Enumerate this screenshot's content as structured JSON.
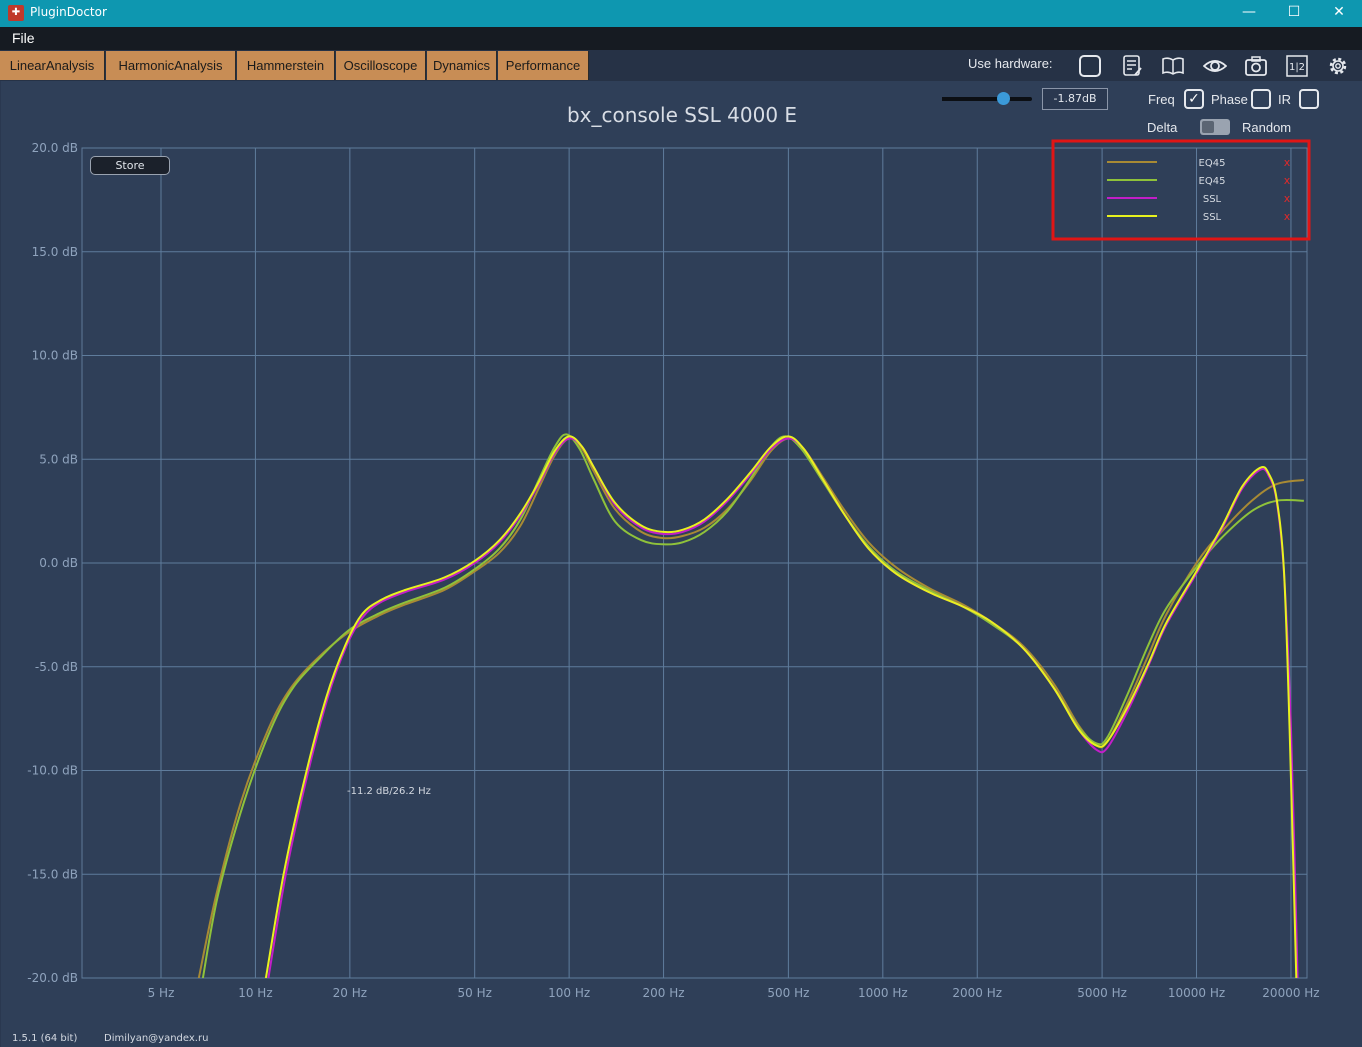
{
  "window": {
    "title": "PluginDoctor",
    "minimize": "—",
    "maximize": "☐",
    "close": "✕"
  },
  "menu": {
    "file": "File"
  },
  "tabs": [
    {
      "label": "LinearAnalysis"
    },
    {
      "label": "HarmonicAnalysis"
    },
    {
      "label": "Hammerstein"
    },
    {
      "label": "Oscilloscope"
    },
    {
      "label": "Dynamics"
    },
    {
      "label": "Performance"
    }
  ],
  "toolbar": {
    "use_hardware_label": "Use hardware:",
    "icons": [
      "hardware-checkbox-icon",
      "notes-icon",
      "book-icon",
      "eye-icon",
      "camera-icon",
      "split-view-icon",
      "settings-gear-icon"
    ],
    "split_label": "1|2"
  },
  "controls": {
    "gain_value": "-1.87dB",
    "gain_slider_fraction": 0.68,
    "freq_label": "Freq",
    "freq_checked": true,
    "phase_label": "Phase",
    "phase_checked": false,
    "ir_label": "IR",
    "ir_checked": false,
    "delta_label": "Delta",
    "random_label": "Random",
    "store_label": "Store"
  },
  "cursor_readout": "-11.2 dB/26.2 Hz",
  "footer": {
    "version": "1.5.1 (64 bit)",
    "email": "Dimilyan@yandex.ru"
  },
  "chart_data": {
    "type": "line",
    "title": "bx_console SSL 4000 E",
    "xscale": "log",
    "xlim": [
      2.8,
      22500
    ],
    "ylim": [
      -20,
      20
    ],
    "grid": true,
    "legend_position": "top-right",
    "x_ticks": [
      {
        "v": 5,
        "label": "5 Hz"
      },
      {
        "v": 10,
        "label": "10 Hz"
      },
      {
        "v": 20,
        "label": "20 Hz"
      },
      {
        "v": 50,
        "label": "50 Hz"
      },
      {
        "v": 100,
        "label": "100 Hz"
      },
      {
        "v": 200,
        "label": "200 Hz"
      },
      {
        "v": 500,
        "label": "500 Hz"
      },
      {
        "v": 1000,
        "label": "1000 Hz"
      },
      {
        "v": 2000,
        "label": "2000 Hz"
      },
      {
        "v": 5000,
        "label": "5000 Hz"
      },
      {
        "v": 10000,
        "label": "10000 Hz"
      },
      {
        "v": 20000,
        "label": "20000 Hz"
      }
    ],
    "y_ticks": [
      {
        "v": 20,
        "label": "20.0 dB"
      },
      {
        "v": 15,
        "label": "15.0 dB"
      },
      {
        "v": 10,
        "label": "10.0 dB"
      },
      {
        "v": 5,
        "label": "5.0 dB"
      },
      {
        "v": 0,
        "label": "0.0 dB"
      },
      {
        "v": -5,
        "label": "-5.0 dB"
      },
      {
        "v": -10,
        "label": "-10.0 dB"
      },
      {
        "v": -15,
        "label": "-15.0 dB"
      },
      {
        "v": -20,
        "label": "-20.0 dB"
      }
    ],
    "series": [
      {
        "name": "EQ45",
        "color": "#a88a34",
        "points": [
          [
            6.6,
            -20
          ],
          [
            7.5,
            -16
          ],
          [
            9,
            -11.5
          ],
          [
            11,
            -8
          ],
          [
            13,
            -6
          ],
          [
            16,
            -4.5
          ],
          [
            20,
            -3.3
          ],
          [
            25,
            -2.5
          ],
          [
            30,
            -2
          ],
          [
            40,
            -1.3
          ],
          [
            50,
            -0.4
          ],
          [
            60,
            0.5
          ],
          [
            70,
            1.8
          ],
          [
            80,
            3.6
          ],
          [
            90,
            5.2
          ],
          [
            100,
            6
          ],
          [
            110,
            5.5
          ],
          [
            120,
            4.4
          ],
          [
            140,
            2.6
          ],
          [
            170,
            1.5
          ],
          [
            200,
            1.2
          ],
          [
            230,
            1.3
          ],
          [
            270,
            1.7
          ],
          [
            320,
            2.6
          ],
          [
            380,
            4
          ],
          [
            440,
            5.4
          ],
          [
            500,
            6
          ],
          [
            560,
            5.5
          ],
          [
            640,
            4.2
          ],
          [
            750,
            2.6
          ],
          [
            900,
            1
          ],
          [
            1100,
            -0.2
          ],
          [
            1400,
            -1.2
          ],
          [
            1800,
            -2
          ],
          [
            2200,
            -2.8
          ],
          [
            2800,
            -4
          ],
          [
            3500,
            -5.8
          ],
          [
            4200,
            -7.8
          ],
          [
            4800,
            -8.8
          ],
          [
            5200,
            -8.6
          ],
          [
            6000,
            -6.8
          ],
          [
            7000,
            -4.5
          ],
          [
            8000,
            -2.5
          ],
          [
            10000,
            0
          ],
          [
            12000,
            1.5
          ],
          [
            15000,
            3
          ],
          [
            18000,
            3.8
          ],
          [
            22000,
            4
          ]
        ]
      },
      {
        "name": "EQ45",
        "color": "#8fc23a",
        "points": [
          [
            6.8,
            -20
          ],
          [
            7.6,
            -16
          ],
          [
            9.2,
            -11.5
          ],
          [
            11.2,
            -8
          ],
          [
            13.2,
            -6
          ],
          [
            16.2,
            -4.5
          ],
          [
            20,
            -3.2
          ],
          [
            25,
            -2.4
          ],
          [
            30,
            -1.9
          ],
          [
            40,
            -1.2
          ],
          [
            50,
            -0.3
          ],
          [
            60,
            0.7
          ],
          [
            70,
            2.1
          ],
          [
            80,
            4
          ],
          [
            90,
            5.6
          ],
          [
            98,
            6.2
          ],
          [
            108,
            5.5
          ],
          [
            120,
            4
          ],
          [
            140,
            2
          ],
          [
            170,
            1.1
          ],
          [
            200,
            0.9
          ],
          [
            230,
            1
          ],
          [
            270,
            1.5
          ],
          [
            320,
            2.5
          ],
          [
            380,
            4.1
          ],
          [
            440,
            5.6
          ],
          [
            490,
            6.1
          ],
          [
            550,
            5.5
          ],
          [
            640,
            4
          ],
          [
            750,
            2.4
          ],
          [
            900,
            0.8
          ],
          [
            1100,
            -0.4
          ],
          [
            1400,
            -1.3
          ],
          [
            1800,
            -2.1
          ],
          [
            2200,
            -2.9
          ],
          [
            2800,
            -4.1
          ],
          [
            3500,
            -6
          ],
          [
            4200,
            -7.9
          ],
          [
            4800,
            -8.7
          ],
          [
            5200,
            -8.4
          ],
          [
            6000,
            -6.4
          ],
          [
            7000,
            -4
          ],
          [
            8000,
            -2.2
          ],
          [
            10000,
            -0.2
          ],
          [
            12000,
            1.2
          ],
          [
            15000,
            2.5
          ],
          [
            18000,
            3
          ],
          [
            22000,
            3
          ]
        ]
      },
      {
        "name": "SSL",
        "color": "#c21ec8",
        "points": [
          [
            11,
            -20
          ],
          [
            12.5,
            -15
          ],
          [
            14.5,
            -10.5
          ],
          [
            17,
            -6.5
          ],
          [
            19.5,
            -4
          ],
          [
            22,
            -2.6
          ],
          [
            25,
            -1.9
          ],
          [
            30,
            -1.4
          ],
          [
            40,
            -0.8
          ],
          [
            50,
            0
          ],
          [
            60,
            1
          ],
          [
            70,
            2.3
          ],
          [
            80,
            3.8
          ],
          [
            90,
            5.3
          ],
          [
            100,
            6
          ],
          [
            110,
            5.6
          ],
          [
            120,
            4.6
          ],
          [
            140,
            2.8
          ],
          [
            170,
            1.7
          ],
          [
            200,
            1.4
          ],
          [
            230,
            1.5
          ],
          [
            270,
            2
          ],
          [
            320,
            3
          ],
          [
            380,
            4.3
          ],
          [
            440,
            5.5
          ],
          [
            500,
            6
          ],
          [
            560,
            5.5
          ],
          [
            640,
            4.1
          ],
          [
            750,
            2.4
          ],
          [
            900,
            0.7
          ],
          [
            1100,
            -0.5
          ],
          [
            1400,
            -1.4
          ],
          [
            1800,
            -2.1
          ],
          [
            2200,
            -2.8
          ],
          [
            2800,
            -4.1
          ],
          [
            3500,
            -6
          ],
          [
            4200,
            -8
          ],
          [
            4800,
            -9
          ],
          [
            5200,
            -8.9
          ],
          [
            6000,
            -7.2
          ],
          [
            7000,
            -5
          ],
          [
            8000,
            -3
          ],
          [
            10000,
            -0.5
          ],
          [
            12000,
            1.6
          ],
          [
            14000,
            3.6
          ],
          [
            16000,
            4.5
          ],
          [
            17000,
            4.2
          ],
          [
            18000,
            3
          ],
          [
            19000,
            -0.5
          ],
          [
            20000,
            -8
          ],
          [
            21000,
            -20
          ]
        ]
      },
      {
        "name": "SSL",
        "color": "#e8f21e",
        "points": [
          [
            10.8,
            -20
          ],
          [
            12.3,
            -15
          ],
          [
            14.3,
            -10.5
          ],
          [
            16.8,
            -6.5
          ],
          [
            19.3,
            -4
          ],
          [
            21.8,
            -2.5
          ],
          [
            25,
            -1.8
          ],
          [
            30,
            -1.3
          ],
          [
            40,
            -0.7
          ],
          [
            50,
            0.1
          ],
          [
            60,
            1.1
          ],
          [
            70,
            2.4
          ],
          [
            80,
            3.9
          ],
          [
            90,
            5.4
          ],
          [
            100,
            6.1
          ],
          [
            110,
            5.6
          ],
          [
            120,
            4.6
          ],
          [
            140,
            2.9
          ],
          [
            170,
            1.8
          ],
          [
            200,
            1.5
          ],
          [
            230,
            1.6
          ],
          [
            270,
            2.1
          ],
          [
            320,
            3.1
          ],
          [
            380,
            4.4
          ],
          [
            440,
            5.6
          ],
          [
            500,
            6.1
          ],
          [
            560,
            5.5
          ],
          [
            640,
            4.1
          ],
          [
            750,
            2.4
          ],
          [
            900,
            0.7
          ],
          [
            1100,
            -0.5
          ],
          [
            1400,
            -1.4
          ],
          [
            1800,
            -2.1
          ],
          [
            2200,
            -2.8
          ],
          [
            2800,
            -4.1
          ],
          [
            3500,
            -6
          ],
          [
            4200,
            -8
          ],
          [
            4800,
            -8.8
          ],
          [
            5200,
            -8.6
          ],
          [
            6000,
            -7
          ],
          [
            7000,
            -4.9
          ],
          [
            8000,
            -2.9
          ],
          [
            10000,
            -0.4
          ],
          [
            12000,
            1.7
          ],
          [
            14000,
            3.7
          ],
          [
            16000,
            4.6
          ],
          [
            17000,
            4.3
          ],
          [
            18000,
            3.1
          ],
          [
            19000,
            -0.4
          ],
          [
            19800,
            -8
          ],
          [
            20800,
            -20
          ]
        ]
      }
    ]
  }
}
